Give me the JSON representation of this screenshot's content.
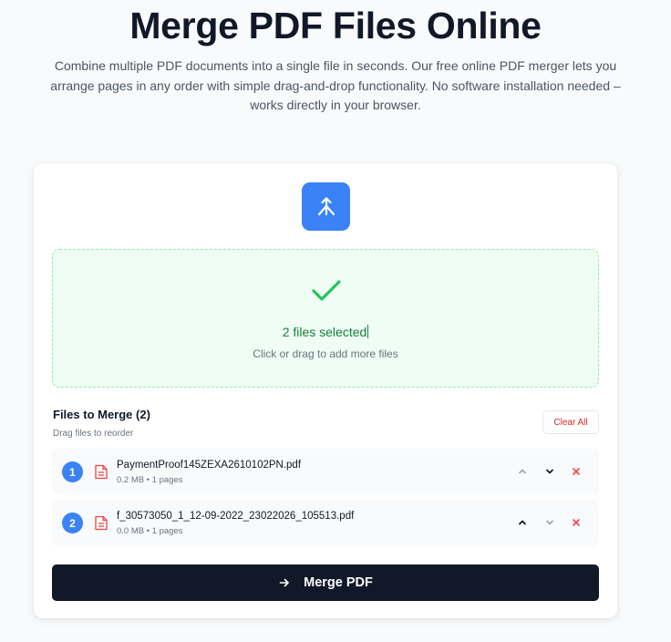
{
  "hero": {
    "title": "Merge PDF Files Online",
    "description": "Combine multiple PDF documents into a single file in seconds. Our free online PDF merger lets you arrange pages in any order with simple drag-and-drop functionality. No software installation needed – works directly in your browser."
  },
  "upload": {
    "logo_icon": "merge-icon",
    "status_icon": "checkmark-icon",
    "status_text": "2 files selected",
    "hint_text": "Click or drag to add more files"
  },
  "files": {
    "heading": "Files to Merge (2)",
    "hint": "Drag files to reorder",
    "clear_label": "Clear All",
    "items": [
      {
        "index": "1",
        "name": "PaymentProof145ZEXA2610102PN.pdf",
        "meta": "0.2 MB • 1 pages",
        "move_up_enabled": false,
        "move_down_enabled": true
      },
      {
        "index": "2",
        "name": "f_30573050_1_12-09-2022_23022026_105513.pdf",
        "meta": "0.0 MB • 1 pages",
        "move_up_enabled": true,
        "move_down_enabled": false
      }
    ]
  },
  "actions": {
    "merge_label": "Merge PDF",
    "merge_icon": "arrow-right-icon"
  },
  "colors": {
    "accent": "#3b82f6",
    "success": "#22c55e",
    "danger": "#dc2626",
    "primary_button": "#111827"
  }
}
